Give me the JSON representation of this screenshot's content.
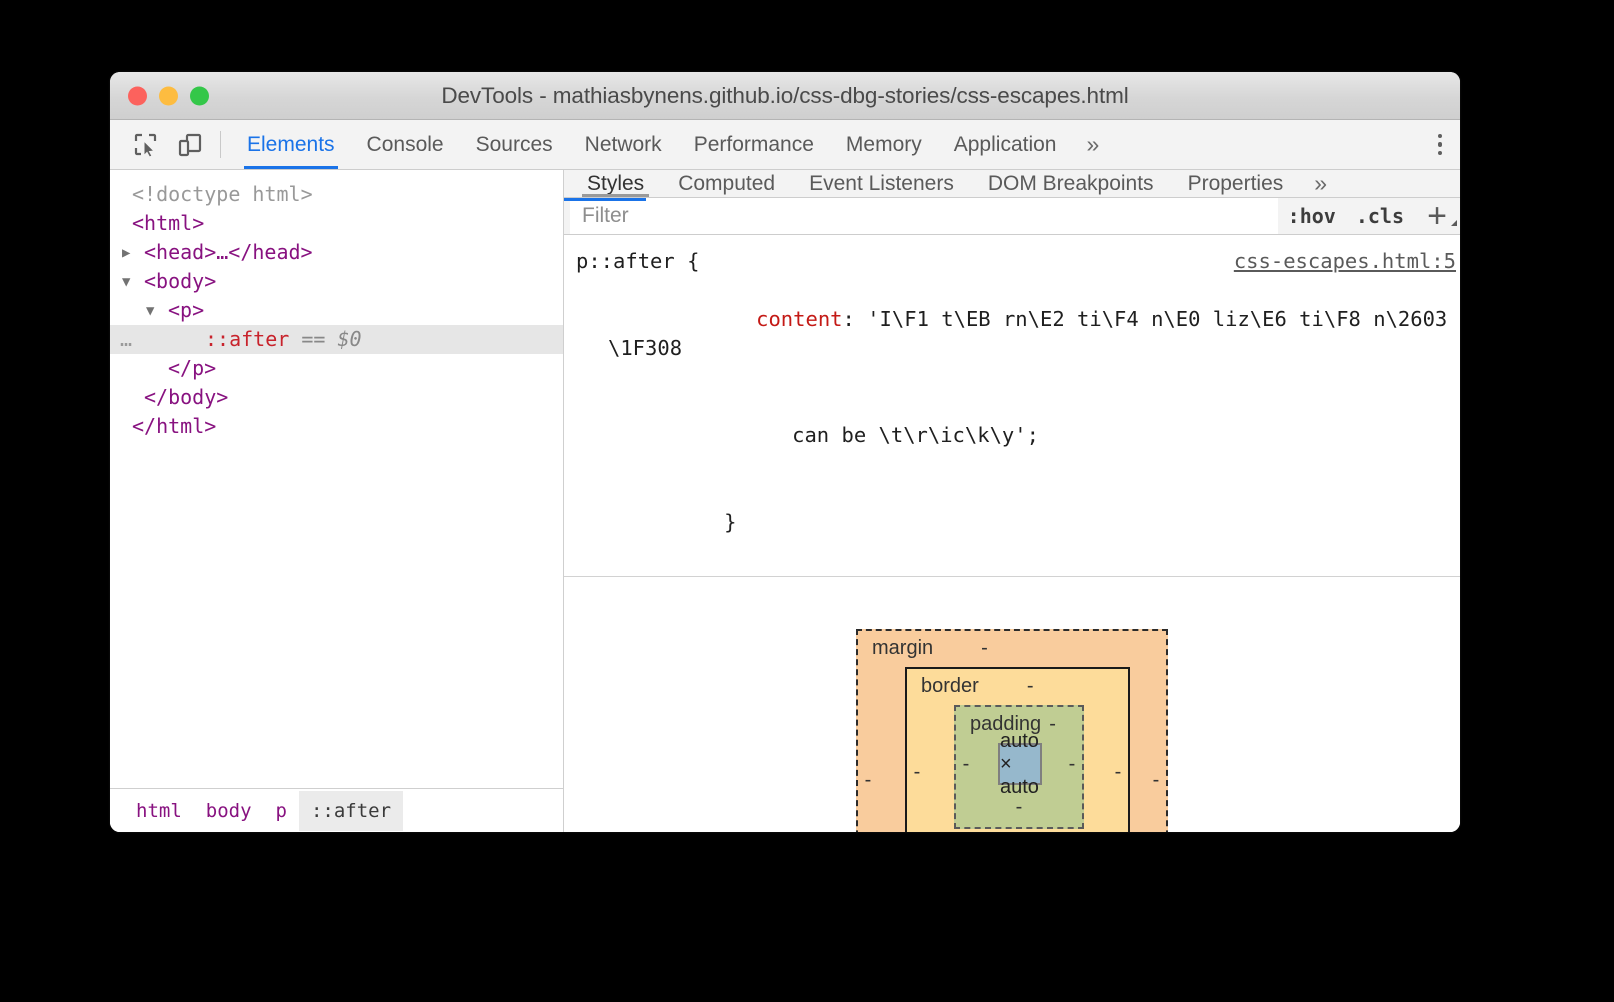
{
  "window": {
    "title": "DevTools - mathiasbynens.github.io/css-dbg-stories/css-escapes.html",
    "traffic_lights": {
      "close": "close",
      "minimize": "minimize",
      "maximize": "maximize"
    }
  },
  "toolbar": {
    "inspect_icon": "inspect-element-icon",
    "device_icon": "device-toolbar-icon",
    "tabs": [
      {
        "label": "Elements",
        "active": true
      },
      {
        "label": "Console",
        "active": false
      },
      {
        "label": "Sources",
        "active": false
      },
      {
        "label": "Network",
        "active": false
      },
      {
        "label": "Performance",
        "active": false
      },
      {
        "label": "Memory",
        "active": false
      },
      {
        "label": "Application",
        "active": false
      }
    ],
    "more_tabs": "»",
    "kebab": "more-options"
  },
  "dom_tree": {
    "rows": [
      {
        "id": "doctype",
        "text": "<!doctype html>"
      },
      {
        "id": "html-open",
        "text": "<html>"
      },
      {
        "id": "head",
        "text": "<head>…</head>"
      },
      {
        "id": "body-open",
        "text": "<body>"
      },
      {
        "id": "p-open",
        "text": "<p>"
      },
      {
        "id": "after",
        "pseudo": "::after",
        "eq": "==",
        "dollar": "$0",
        "ellipsis": "…"
      },
      {
        "id": "p-close",
        "text": "</p>"
      },
      {
        "id": "body-close",
        "text": "</body>"
      },
      {
        "id": "html-close",
        "text": "</html>"
      }
    ]
  },
  "breadcrumb": {
    "items": [
      {
        "label": "html",
        "active": false
      },
      {
        "label": "body",
        "active": false
      },
      {
        "label": "p",
        "active": false
      },
      {
        "label": "::after",
        "active": true
      }
    ]
  },
  "styles_pane": {
    "tabs": [
      {
        "label": "Styles",
        "active": true
      },
      {
        "label": "Computed",
        "active": false
      },
      {
        "label": "Event Listeners",
        "active": false
      },
      {
        "label": "DOM Breakpoints",
        "active": false
      },
      {
        "label": "Properties",
        "active": false
      }
    ],
    "more_tabs": "»",
    "filter": {
      "placeholder": "Filter",
      "value": ""
    },
    "hov_button": ":hov",
    "cls_button": ".cls",
    "new_rule_button": "+"
  },
  "css_rule": {
    "selector": "p::after {",
    "source_link": "css-escapes.html:5",
    "property_name": "content",
    "property_colon": ": ",
    "property_value_line1": "'I\\F1 t\\EB rn\\E2 ti\\F4 n\\E0 liz\\E6 ti\\F8 n\\2603 \\1F308",
    "property_value_line2": "can be \\t\\r\\ic\\k\\y';",
    "close_brace": "}"
  },
  "box_model": {
    "margin_label": "margin",
    "margin_top": "-",
    "margin_left": "-",
    "margin_right": "-",
    "margin_bottom": "-",
    "border_label": "border",
    "border_top": "-",
    "border_left": "-",
    "border_right": "-",
    "border_bottom": "-",
    "padding_label": "padding",
    "padding_top": "-",
    "padding_left": "-",
    "padding_right": "-",
    "padding_bottom": "-",
    "content_size": "auto × auto",
    "colors": {
      "margin": "#f9cc9d",
      "border": "#fddc9a",
      "padding": "#c0cd93",
      "content": "#96b8cc"
    }
  },
  "theme": {
    "accent": "#1a73e8",
    "tag_color": "#881280",
    "pseudo_color": "#c8232c",
    "prop_name_color": "#c41a16",
    "backdrop": "#000000"
  }
}
